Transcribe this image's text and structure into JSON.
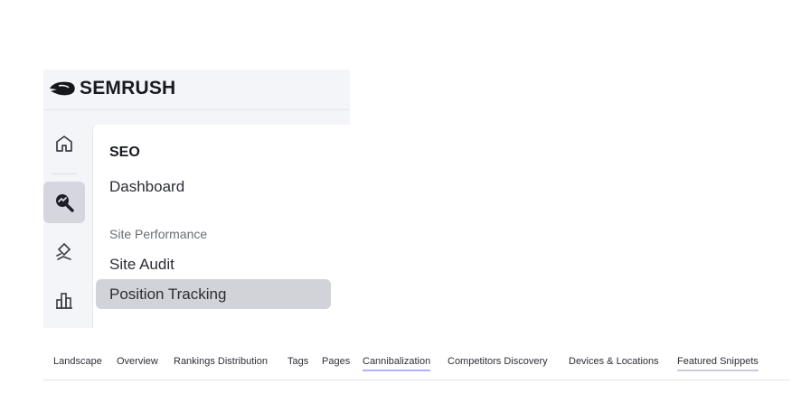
{
  "brand": {
    "name": "SEMRUSH"
  },
  "rail": {
    "items": [
      {
        "icon": "home-icon",
        "active": false
      },
      {
        "icon": "seo-magnifier-icon",
        "active": true
      },
      {
        "icon": "local-pin-icon",
        "active": false
      },
      {
        "icon": "bar-chart-icon",
        "active": false
      }
    ]
  },
  "menu": {
    "title": "SEO",
    "dashboard": "Dashboard",
    "section": "Site Performance",
    "site_audit": "Site Audit",
    "position_tracking": "Position Tracking"
  },
  "tabs": [
    "Landscape",
    "Overview",
    "Rankings Distribution",
    "Tags",
    "Pages",
    "Cannibalization",
    "Competitors Discovery",
    "Devices & Locations",
    "Featured Snippets"
  ],
  "colors": {
    "panel_bg": "#f4f5f9",
    "active_rail": "#d6d7de",
    "selected_item": "#d2d3d9",
    "tab_active_underline": "#b0b1ff"
  }
}
